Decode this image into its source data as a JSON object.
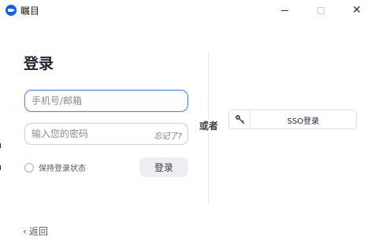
{
  "window": {
    "title": "瞩目",
    "close_glyph": "✕"
  },
  "login": {
    "heading": "登录",
    "account_placeholder": "手机号/邮箱",
    "password_placeholder": "输入您的密码",
    "forgot_label": "忘记了?",
    "remember_label": "保持登录状态",
    "remember_checked": false,
    "submit_label": "登录",
    "back_glyph": "‹",
    "back_label": "返回"
  },
  "alt": {
    "or_label": "或者",
    "sso_label": "SSO登录",
    "sso_icon": "key-icon"
  },
  "colors": {
    "accent": "#0b5cff",
    "focus_border": "#4a8cff",
    "button_bg": "#eceef2"
  }
}
